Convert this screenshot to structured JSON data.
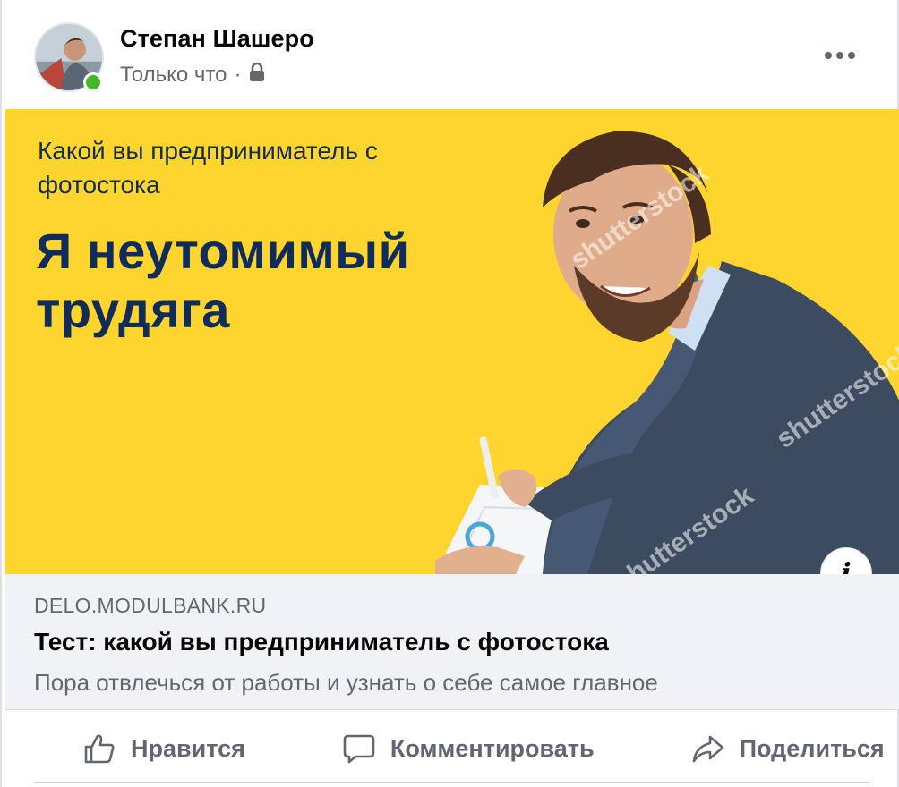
{
  "post": {
    "author_name": "Степан Шашеро",
    "timestamp": "Только что",
    "separator": "·",
    "privacy_icon": "lock-icon",
    "more_icon": "more-dots-icon"
  },
  "ad": {
    "subtitle": "Какой вы предприниматель с фотостока",
    "headline": "Я неутомимый трудяга",
    "watermark_text": "shutterstock",
    "info_label": "i",
    "colors": {
      "background": "#fed52f",
      "headline": "#0f2c5a"
    }
  },
  "link": {
    "domain": "DELO.MODULBANK.RU",
    "title": "Тест: какой вы предприниматель с фотостока",
    "description": "Пора отвлечься от работы и узнать о себе самое главное"
  },
  "actions": {
    "like_label": "Нравится",
    "comment_label": "Комментировать",
    "share_label": "Поделиться",
    "like_icon": "thumbs-up-icon",
    "comment_icon": "comment-icon",
    "share_icon": "share-icon"
  }
}
